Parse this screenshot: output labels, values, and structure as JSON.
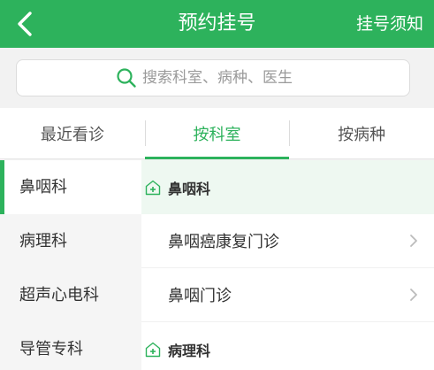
{
  "header": {
    "title": "预约挂号",
    "notice_label": "挂号须知"
  },
  "search": {
    "placeholder": "搜索科室、病种、医生"
  },
  "tabs": [
    {
      "label": "最近看诊"
    },
    {
      "label": "按科室"
    },
    {
      "label": "按病种"
    }
  ],
  "sidebar": {
    "items": [
      {
        "label": "鼻咽科"
      },
      {
        "label": "病理科"
      },
      {
        "label": "超声心电科"
      },
      {
        "label": "导管专科"
      }
    ]
  },
  "content": {
    "groups": [
      {
        "label": "鼻咽科",
        "clinics": [
          {
            "label": "鼻咽癌康复门诊"
          },
          {
            "label": "鼻咽门诊"
          }
        ]
      },
      {
        "label": "病理科"
      }
    ]
  },
  "colors": {
    "accent": "#2db25c"
  }
}
